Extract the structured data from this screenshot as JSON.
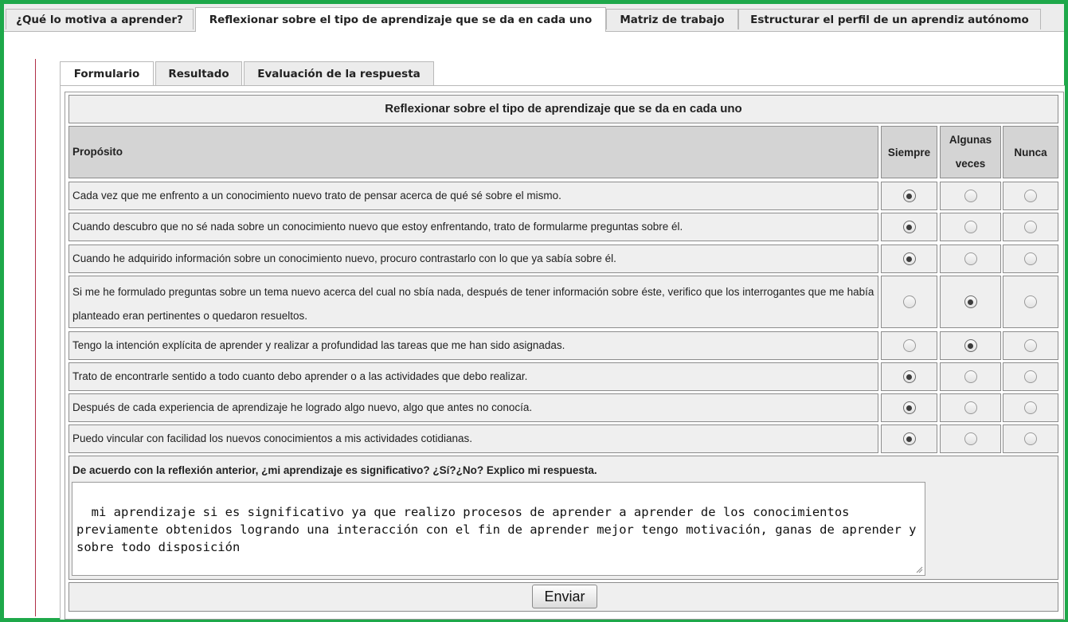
{
  "top_tabs": [
    {
      "label": "¿Qué lo motiva a aprender?",
      "active": false
    },
    {
      "label": "Reflexionar sobre el tipo de aprendizaje que se da en cada uno",
      "active": true
    },
    {
      "label": "Matriz de trabajo",
      "active": false
    },
    {
      "label": "Estructurar el perfil de un aprendiz autónomo",
      "active": false
    }
  ],
  "inner_tabs": [
    {
      "label": "Formulario",
      "active": true
    },
    {
      "label": "Resultado",
      "active": false
    },
    {
      "label": "Evaluación de la respuesta",
      "active": false
    }
  ],
  "form": {
    "title": "Reflexionar sobre el tipo de aprendizaje que se da en cada uno",
    "header_purpose": "Propósito",
    "header_siempre": "Siempre",
    "header_algunas": "Algunas veces",
    "header_nunca": "Nunca",
    "rows": [
      {
        "text": "Cada vez que me enfrento a un conocimiento nuevo trato de pensar acerca de qué sé sobre el mismo.",
        "selected": "siempre"
      },
      {
        "text": "Cuando descubro que no sé nada sobre un conocimiento nuevo que estoy enfrentando, trato de formularme preguntas sobre él.",
        "selected": "siempre"
      },
      {
        "text": "Cuando he adquirido información sobre un conocimiento nuevo, procuro contrastarlo con lo que ya sabía sobre él.",
        "selected": "siempre"
      },
      {
        "text": "Si me he formulado preguntas sobre un tema nuevo acerca del cual no sbía nada, después de tener información sobre éste, verifico que los interrogantes que me había planteado eran pertinentes o quedaron resueltos.",
        "selected": "algunas"
      },
      {
        "text": "Tengo la intención explícita de aprender y realizar a profundidad las tareas que me han sido asignadas.",
        "selected": "algunas"
      },
      {
        "text": "Trato de encontrarle sentido a todo cuanto debo aprender o a las actividades que debo realizar.",
        "selected": "siempre"
      },
      {
        "text": "Después de cada experiencia de aprendizaje he logrado algo nuevo, algo que antes no conocía.",
        "selected": "siempre"
      },
      {
        "text": "Puedo vincular con facilidad los nuevos conocimientos a mis actividades cotidianas.",
        "selected": "siempre"
      }
    ],
    "question": "De acuerdo con la reflexión anterior, ¿mi aprendizaje es significativo? ¿Sí?¿No? Explico mi respuesta.",
    "answer": "mi aprendizaje si es significativo ya que realizo procesos de aprender a aprender de los conocimientos previamente obtenidos logrando una interacción con el fin de aprender mejor tengo motivación, ganas de aprender y sobre todo disposición",
    "submit_label": "Enviar"
  }
}
